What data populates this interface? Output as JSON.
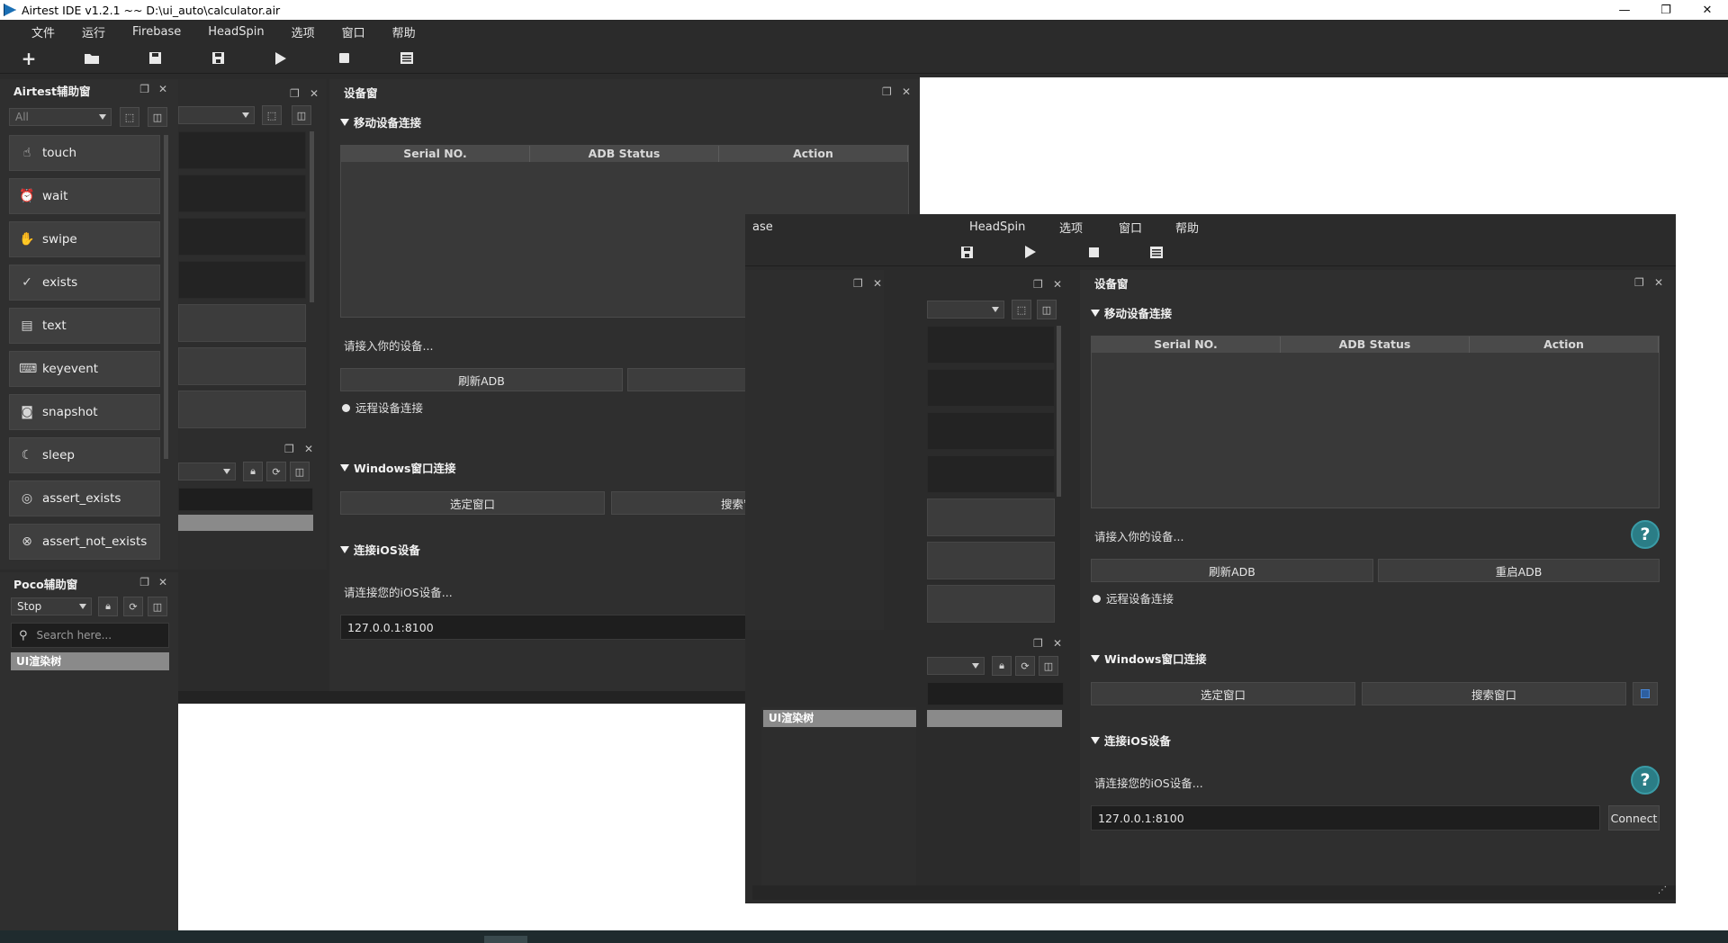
{
  "window": {
    "title": "Airtest IDE v1.2.1 ~~ D:\\ui_auto\\calculator.air"
  },
  "menu": [
    "文件",
    "运行",
    "Firebase",
    "HeadSpin",
    "选项",
    "窗口",
    "帮助"
  ],
  "menu_clipped": [
    "ase",
    "HeadSpin",
    "选项",
    "窗口",
    "帮助"
  ],
  "toolbar": {
    "icons": [
      "plus-icon",
      "folder-icon",
      "save-icon",
      "save-as-icon",
      "play-icon",
      "stop-icon",
      "log-icon"
    ]
  },
  "airtest_panel": {
    "title": "Airtest辅助窗",
    "filter_placeholder": "All",
    "items": [
      {
        "label": "touch",
        "icon": "☝"
      },
      {
        "label": "wait",
        "icon": "⏰"
      },
      {
        "label": "swipe",
        "icon": "✋"
      },
      {
        "label": "exists",
        "icon": "✓"
      },
      {
        "label": "text",
        "icon": "▤"
      },
      {
        "label": "keyevent",
        "icon": "⌨"
      },
      {
        "label": "snapshot",
        "icon": "◙"
      },
      {
        "label": "sleep",
        "icon": "☾"
      },
      {
        "label": "assert_exists",
        "icon": "◎"
      },
      {
        "label": "assert_not_exists",
        "icon": "⊗"
      }
    ]
  },
  "poco_panel": {
    "title": "Poco辅助窗",
    "mode": "Stop",
    "search_placeholder": "Search here...",
    "tree_root": "UI渲染树"
  },
  "device_panel": {
    "title": "设备窗",
    "mobile_section": "移动设备连接",
    "table_headers": [
      "Serial NO.",
      "ADB Status",
      "Action"
    ],
    "connect_hint": "请接入你的设备...",
    "refresh_adb": "刷新ADB",
    "restart_adb": "重启ADB",
    "remote_connect": "远程设备连接",
    "windows_section": "Windows窗口连接",
    "select_window": "选定窗口",
    "search_window": "搜索窗口",
    "ios_section": "连接iOS设备",
    "ios_hint": "请连接您的iOS设备...",
    "ios_address": "127.0.0.1:8100",
    "connect": "Connect"
  }
}
